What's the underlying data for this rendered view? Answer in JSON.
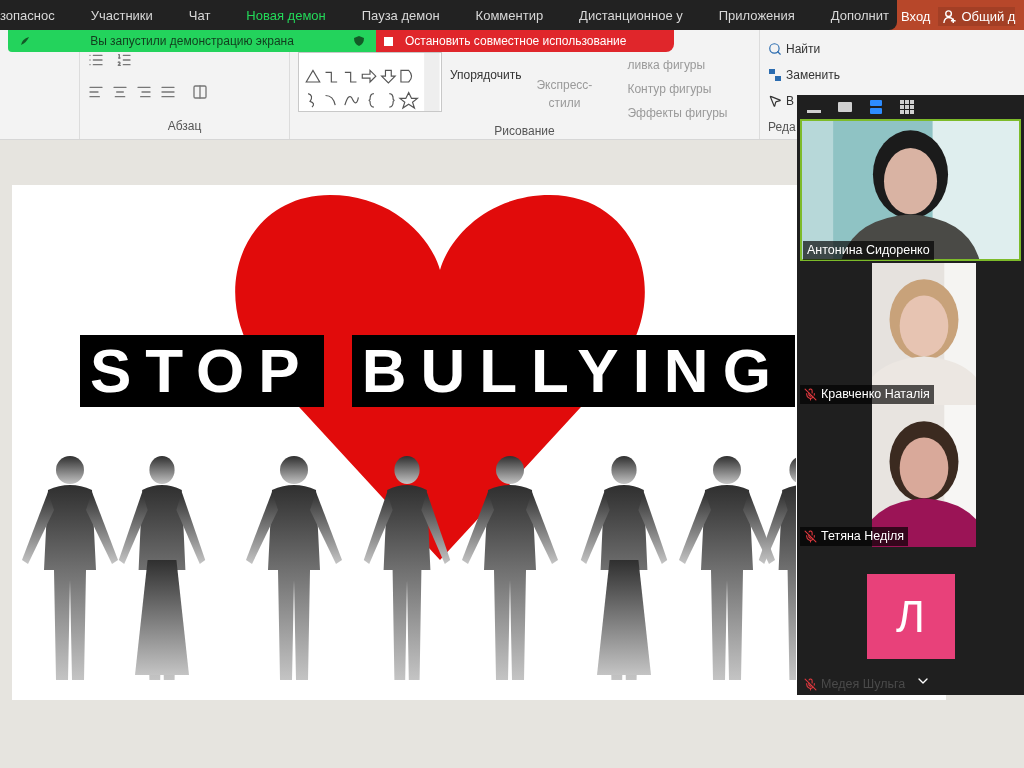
{
  "zoom_toolbar": {
    "items": [
      {
        "label": "зопаснос",
        "selected": false
      },
      {
        "label": "Участники",
        "selected": false
      },
      {
        "label": "Чат",
        "selected": false
      },
      {
        "label": "Новая демон",
        "selected": true
      },
      {
        "label": "Пауза демон",
        "selected": false
      },
      {
        "label": "Комментир",
        "selected": false
      },
      {
        "label": "Дистанционное у",
        "selected": false
      },
      {
        "label": "Приложения",
        "selected": false
      },
      {
        "label": "Дополнит",
        "selected": false
      }
    ]
  },
  "title_bar": {
    "sign_in": "Вход",
    "share": "Общий д"
  },
  "share_banner": {
    "message": "Вы запустили демонстрацию экрана",
    "stop_button": "Остановить совместное использование"
  },
  "ribbon": {
    "groups": [
      "Абзац",
      "Рисование",
      "Реда"
    ],
    "drawing": {
      "arrange": "Упорядочить",
      "styles": "Экспресс-стили",
      "fill": "ливка фигуры",
      "outline": "Контур фигуры",
      "effects": "Эффекты фигуры"
    },
    "editing": {
      "find": "Найти",
      "replace": "Заменить",
      "select": "В"
    }
  },
  "slide": {
    "words": [
      "STOP",
      "BULLYING"
    ]
  },
  "video_panel": {
    "views": [
      {
        "kind": "minimize",
        "selected": false
      },
      {
        "kind": "single",
        "selected": false
      },
      {
        "kind": "strip",
        "selected": true
      },
      {
        "kind": "grid",
        "selected": false
      }
    ],
    "participants": [
      {
        "name": "Антонина Сидоренко",
        "kind": "video",
        "speaking": true,
        "muted": false
      },
      {
        "name": "Кравченко Наталія",
        "kind": "video",
        "speaking": false,
        "muted": true
      },
      {
        "name": "Тетяна Неділя",
        "kind": "video",
        "speaking": false,
        "muted": true
      },
      {
        "name": "Медея Шульга",
        "kind": "avatar",
        "initial": "Л",
        "color": "#e8417a",
        "speaking": false,
        "muted": true
      }
    ]
  }
}
